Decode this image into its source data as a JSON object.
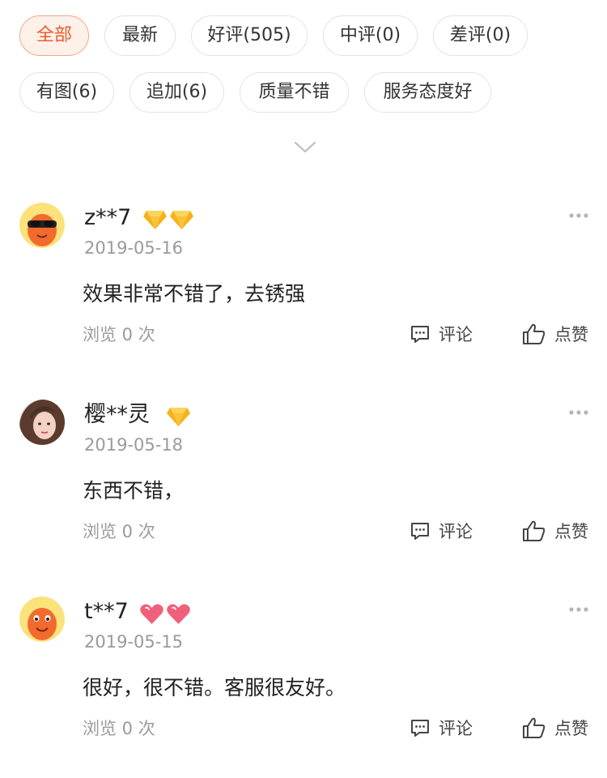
{
  "filters": {
    "row1": [
      {
        "label": "全部",
        "active": true
      },
      {
        "label": "最新",
        "active": false
      },
      {
        "label": "好评(505)",
        "active": false
      },
      {
        "label": "中评(0)",
        "active": false
      },
      {
        "label": "差评(0)",
        "active": false
      }
    ],
    "row2": [
      {
        "label": "有图(6)",
        "active": false
      },
      {
        "label": "追加(6)",
        "active": false
      },
      {
        "label": "质量不错",
        "active": false
      },
      {
        "label": "服务态度好",
        "active": false
      }
    ],
    "expand_icon": "chevron-down-icon"
  },
  "reviews": [
    {
      "username": "z**7",
      "badges": [
        "diamond",
        "diamond"
      ],
      "date": "2019-05-16",
      "content": "效果非常不错了，去锈强",
      "views": "浏览 0 次",
      "comment_label": "评论",
      "like_label": "点赞"
    },
    {
      "username": "樱**灵",
      "badges": [
        "diamond"
      ],
      "date": "2019-05-18",
      "content": "东西不错，",
      "views": "浏览 0 次",
      "comment_label": "评论",
      "like_label": "点赞"
    },
    {
      "username": "t**7",
      "badges": [
        "heart",
        "heart"
      ],
      "date": "2019-05-15",
      "content": "很好，很不错。客服很友好。",
      "views": "浏览 0 次",
      "comment_label": "评论",
      "like_label": "点赞"
    }
  ],
  "colors": {
    "accent": "#ee5a2d",
    "accent_bg": "#fdf1ea",
    "muted_text": "#9a9a9a",
    "diamond": "#f6b21b",
    "heart": "#f0607a"
  }
}
